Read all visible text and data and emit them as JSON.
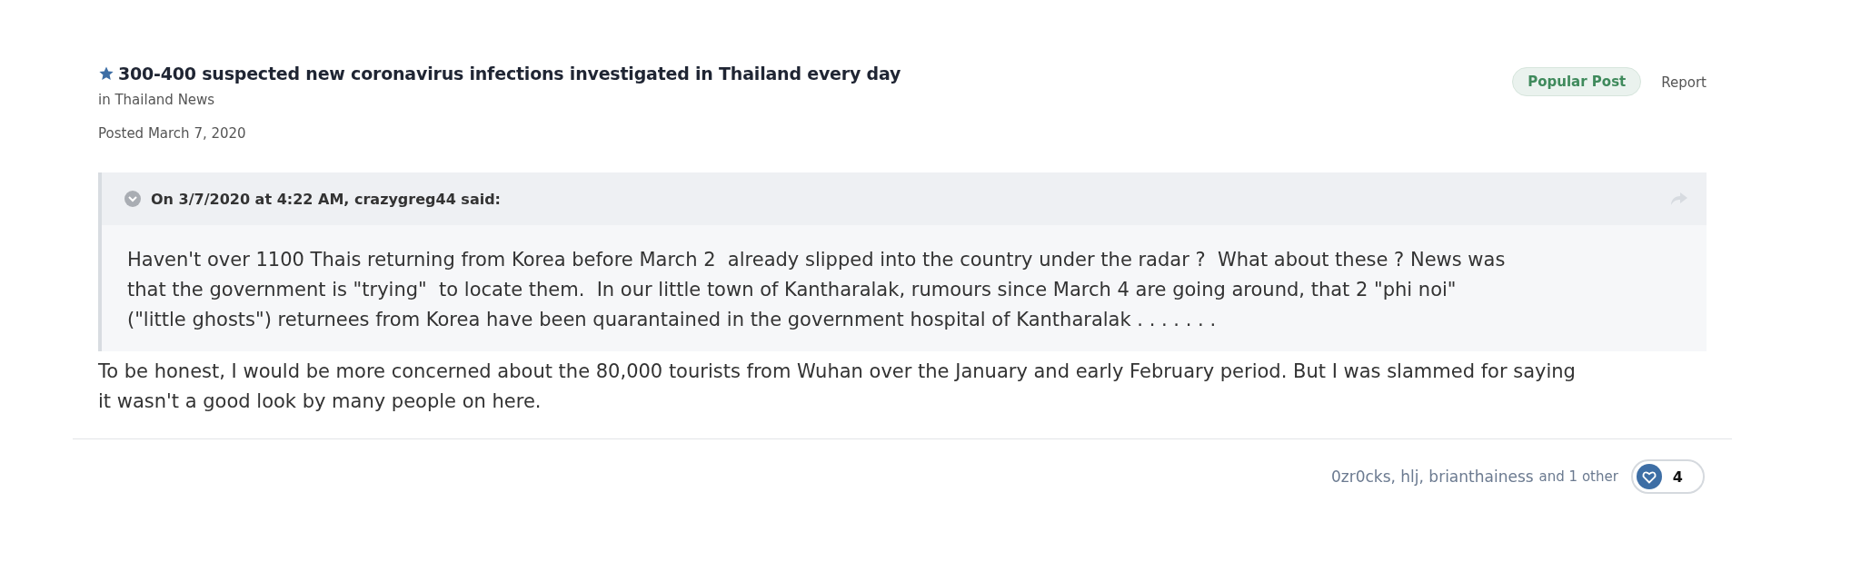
{
  "post": {
    "featured": true,
    "title": "300-400 suspected new coronavirus infections investigated in Thailand every day",
    "forum": "in Thailand News",
    "posted": "Posted March 7, 2020",
    "badges": [
      {
        "kind": "pill",
        "label": "Popular Post"
      },
      {
        "kind": "link",
        "label": "Report"
      }
    ]
  },
  "quote": {
    "header": "On 3/7/2020 at 4:22 AM, crazygreg44 said:",
    "expanded": true,
    "text": "Haven't over 1100 Thais returning from Korea before March 2  already slipped into the country under the radar ?  What about these ? News was that the government is \"trying\"  to locate them.  In our little town of Kantharalak, rumours since March 4 are going around, that 2 \"phi noi\" (\"little ghosts\") returnees from Korea have been quarantained in the government hospital of Kantharalak . . . . . . ."
  },
  "reply": "To be honest, I would be more concerned about the 80,000 tourists from Wuhan over the January and early February period. But I was slammed for saying it wasn't a good look by many people on here.",
  "reactions": {
    "names": "0zr0cks, hlj, brianthainess",
    "others": "and 1 other",
    "count": "4"
  }
}
